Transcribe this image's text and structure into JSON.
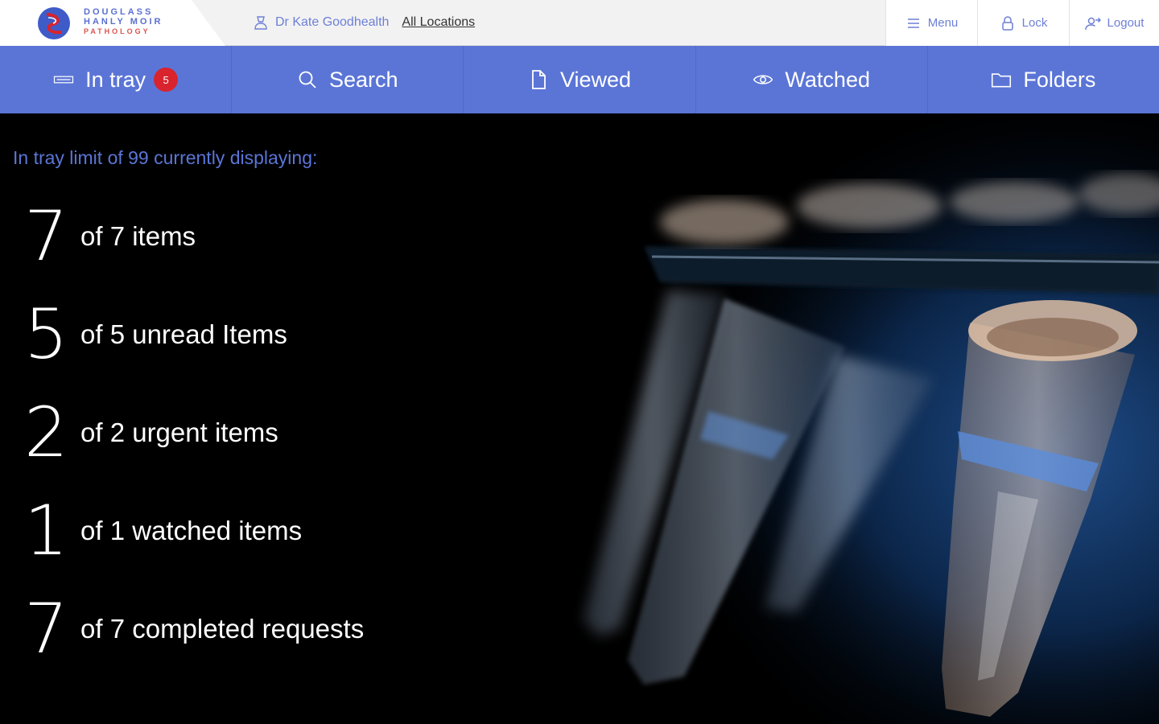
{
  "brand": {
    "line1": "DOUGLASS",
    "line2": "HANLY MOIR",
    "line3": "PATHOLOGY",
    "primary_color": "#5b75d6",
    "accent_color": "#d9232d"
  },
  "header": {
    "user_name": "Dr Kate Goodhealth",
    "locations_link": "All Locations",
    "menu_label": "Menu",
    "lock_label": "Lock",
    "logout_label": "Logout"
  },
  "nav": {
    "tabs": [
      {
        "label": "In tray",
        "icon": "inbox-icon",
        "badge": "5"
      },
      {
        "label": "Search",
        "icon": "search-icon"
      },
      {
        "label": "Viewed",
        "icon": "document-icon"
      },
      {
        "label": "Watched",
        "icon": "eye-icon"
      },
      {
        "label": "Folders",
        "icon": "folder-icon"
      }
    ]
  },
  "main": {
    "limit_text": "In tray limit of 99 currently displaying:",
    "stats": [
      {
        "number": "7",
        "label": "of 7 items"
      },
      {
        "number": "5",
        "label": "of 5 unread Items"
      },
      {
        "number": "2",
        "label": "of 2 urgent items"
      },
      {
        "number": "1",
        "label": "of 1 watched items"
      },
      {
        "number": "7",
        "label": "of 7 completed requests"
      }
    ]
  }
}
